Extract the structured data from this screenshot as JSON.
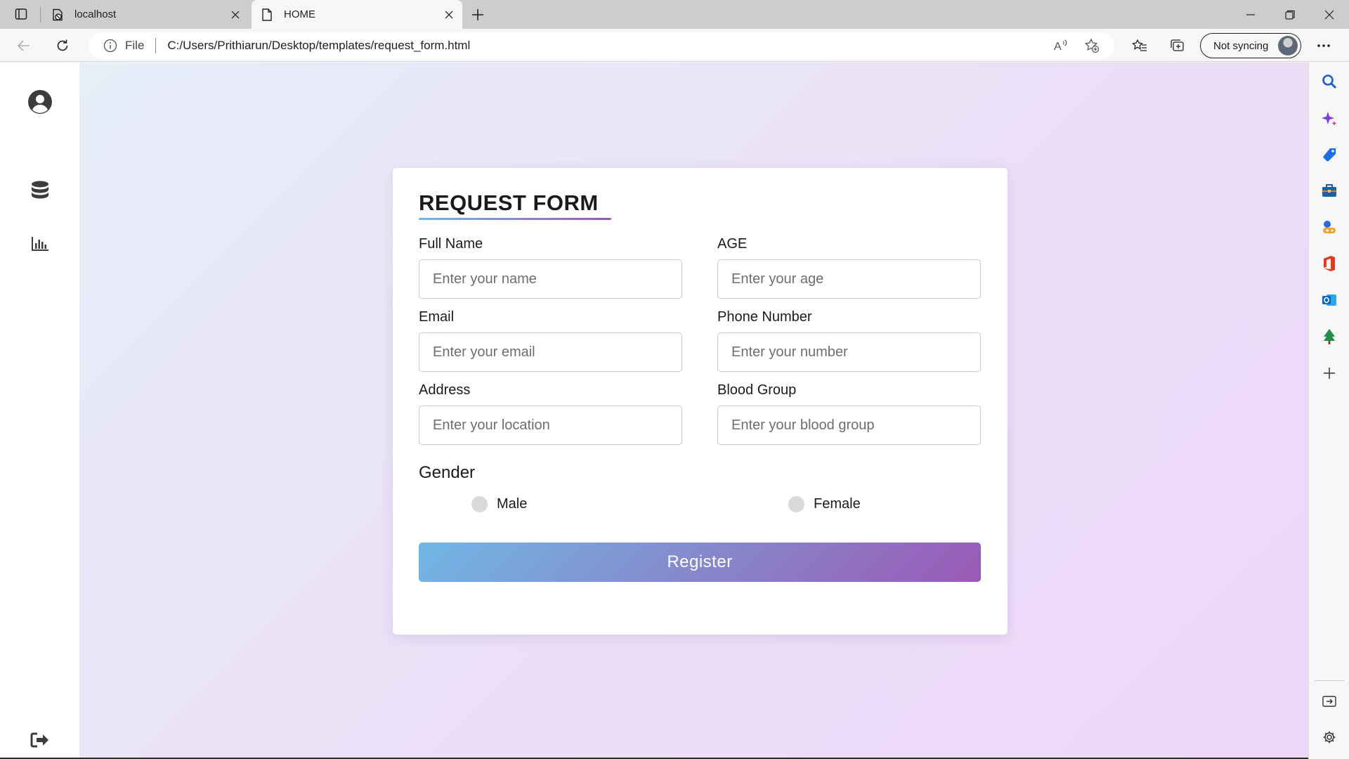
{
  "browser": {
    "tabs": [
      {
        "title": "localhost",
        "icon": "page-blocked-icon",
        "active": false
      },
      {
        "title": "HOME",
        "icon": "document-icon",
        "active": true
      }
    ],
    "address": {
      "scheme_label": "File",
      "url": "C:/Users/Prithiarun/Desktop/templates/request_form.html"
    },
    "profile": {
      "label": "Not syncing"
    },
    "sidebar_icons": [
      "search-icon",
      "copilot-icon",
      "shopping-icon",
      "tools-icon",
      "games-icon",
      "office-icon",
      "outlook-icon",
      "tree-icon",
      "add-icon"
    ]
  },
  "app_sidebar": {
    "icons": [
      "user-circle-icon",
      "database-icon",
      "bar-chart-icon",
      "logout-icon"
    ]
  },
  "form": {
    "title": "REQUEST FORM",
    "fields": [
      {
        "label": "Full Name",
        "placeholder": "Enter your name",
        "value": ""
      },
      {
        "label": "AGE",
        "placeholder": "Enter your age",
        "value": ""
      },
      {
        "label": "Email",
        "placeholder": "Enter your email",
        "value": ""
      },
      {
        "label": "Phone Number",
        "placeholder": "Enter your number",
        "value": ""
      },
      {
        "label": "Address",
        "placeholder": "Enter your location",
        "value": ""
      },
      {
        "label": "Blood Group",
        "placeholder": "Enter your blood group",
        "value": ""
      }
    ],
    "gender": {
      "title": "Gender",
      "options": [
        "Male",
        "Female"
      ],
      "selected": null
    },
    "submit_label": "Register"
  },
  "colors": {
    "gradient_start": "#71b7e6",
    "gradient_end": "#9b59b6",
    "page_bg_start": "#e6eef8",
    "page_bg_end": "#eed6f8"
  }
}
